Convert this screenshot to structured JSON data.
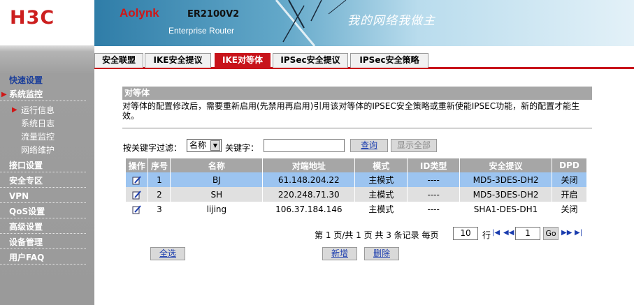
{
  "logo": "H3C",
  "banner": {
    "brand": "Aolynk",
    "model": "ER2100V2",
    "subtitle": "Enterprise Router",
    "slogan": "我的网络我做主"
  },
  "tabs": [
    {
      "label": "安全联盟",
      "active": false
    },
    {
      "label": "IKE安全提议",
      "active": false
    },
    {
      "label": "IKE对等体",
      "active": true
    },
    {
      "label": "IPSec安全提议",
      "active": false
    },
    {
      "label": "IPSec安全策略",
      "active": false
    }
  ],
  "sidebar": {
    "quick": "快速设置",
    "items": [
      {
        "label": "系统监控"
      },
      {
        "label": "接口设置"
      },
      {
        "label": "安全专区"
      },
      {
        "label": "VPN"
      },
      {
        "label": "QoS设置"
      },
      {
        "label": "高级设置"
      },
      {
        "label": "设备管理"
      },
      {
        "label": "用户FAQ"
      }
    ],
    "subitems": [
      "运行信息",
      "系统日志",
      "流量监控",
      "网络维护"
    ]
  },
  "section": {
    "title": "对等体",
    "desc": "对等体的配置修改后，需要重新启用(先禁用再启用)引用该对等体的IPSEC安全策略或重新使能IPSEC功能，新的配置才能生效。"
  },
  "filter": {
    "label": "按关键字过滤：",
    "select_value": "名称",
    "keyword_label": "关键字：",
    "keyword_value": "",
    "search_button": "查询",
    "show_all_button": "显示全部"
  },
  "table": {
    "headers": [
      "操作",
      "序号",
      "名称",
      "对端地址",
      "模式",
      "ID类型",
      "安全提议",
      "DPD"
    ],
    "rows": [
      {
        "no": "1",
        "name": "BJ",
        "addr": "61.148.204.22",
        "mode": "主模式",
        "idtype": "----",
        "proposal": "MD5-3DES-DH2",
        "dpd": "关闭"
      },
      {
        "no": "2",
        "name": "SH",
        "addr": "220.248.71.30",
        "mode": "主模式",
        "idtype": "----",
        "proposal": "MD5-3DES-DH2",
        "dpd": "开启"
      },
      {
        "no": "3",
        "name": "lijing",
        "addr": "106.37.184.146",
        "mode": "主模式",
        "idtype": "----",
        "proposal": "SHA1-DES-DH1",
        "dpd": "关闭"
      }
    ]
  },
  "pager": {
    "summary": "第 1 页/共 1 页 共 3 条记录 每页",
    "per_page": "10",
    "row_label": "行",
    "page_input": "1",
    "go": "Go"
  },
  "actions": {
    "select_all": "全选",
    "add": "新增",
    "delete": "删除"
  }
}
